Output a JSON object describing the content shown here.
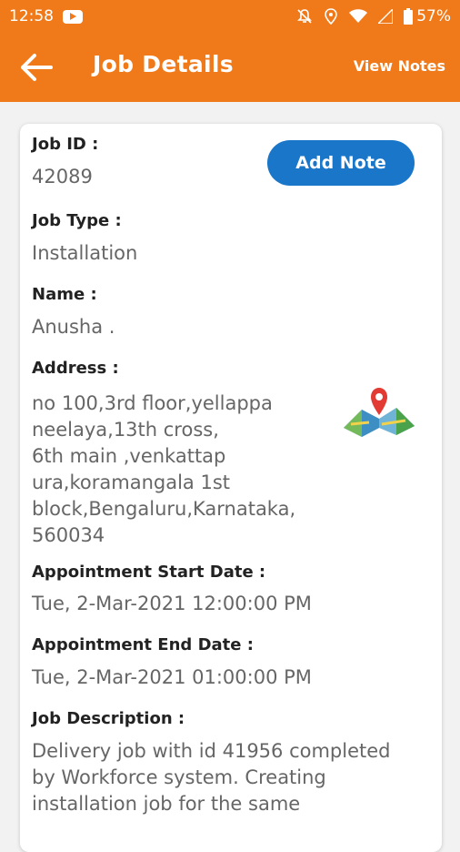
{
  "status_bar": {
    "time": "12:58",
    "battery": "57%",
    "icons": [
      "youtube-icon",
      "mute-icon",
      "location-icon",
      "wifi-icon",
      "signal-icon",
      "battery-icon"
    ]
  },
  "app_bar": {
    "title": "Job Details",
    "view_notes": "View Notes",
    "back_icon": "arrow-left-icon",
    "color": "#f07a1a"
  },
  "card": {
    "add_note": "Add Note",
    "add_note_color": "#1976c9",
    "job_id_label": "Job ID :",
    "job_id": "42089",
    "job_type_label": "Job Type :",
    "job_type": "Installation",
    "name_label": "Name :",
    "name": "Anusha .",
    "address_label": "Address :",
    "address_lines": [
      "no 100,3rd floor,yellappa",
      "neelaya,13th cross,",
      "6th main ,venkattap",
      "ura,koramangala 1st",
      "block,Bengaluru,Karnataka,",
      "560034"
    ],
    "map_icon": "map-pin-icon",
    "start_label": "Appointment Start Date :",
    "start_date": "Tue, 2-Mar-2021 12:00:00 PM",
    "end_label": "Appointment End Date :",
    "end_date": "Tue, 2-Mar-2021 01:00:00 PM",
    "desc_label": "Job Description :",
    "desc_lines": [
      "Delivery job with id 41956 completed",
      "by Workforce system. Creating",
      "installation job for the same"
    ]
  }
}
